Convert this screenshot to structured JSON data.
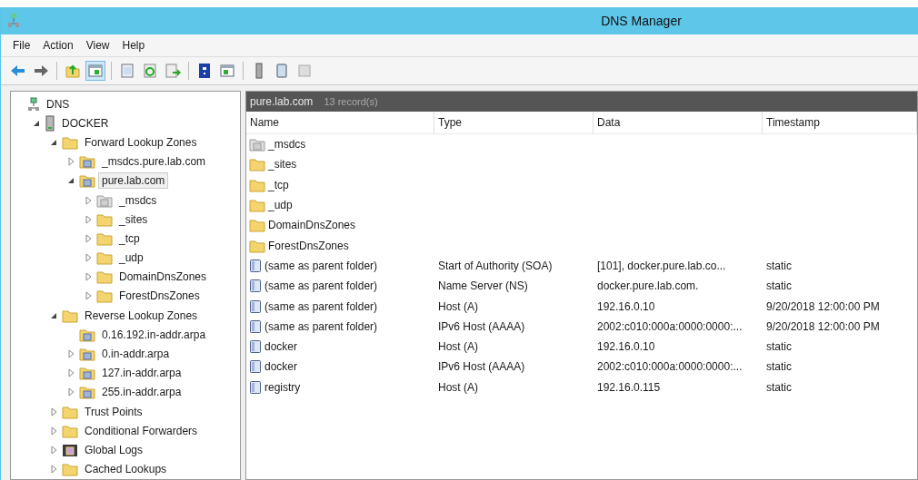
{
  "window": {
    "title": "DNS Manager"
  },
  "menu": [
    "File",
    "Action",
    "View",
    "Help"
  ],
  "toolbar": [
    {
      "kind": "back",
      "pressed": false
    },
    {
      "kind": "forward",
      "pressed": false
    },
    {
      "kind": "sep"
    },
    {
      "kind": "up",
      "pressed": false
    },
    {
      "kind": "tree",
      "pressed": true
    },
    {
      "kind": "sep"
    },
    {
      "kind": "props",
      "pressed": false
    },
    {
      "kind": "refresh",
      "pressed": false
    },
    {
      "kind": "export",
      "pressed": false
    },
    {
      "kind": "sep"
    },
    {
      "kind": "help",
      "pressed": false
    },
    {
      "kind": "pane",
      "pressed": false
    },
    {
      "kind": "sep"
    },
    {
      "kind": "server",
      "pressed": false
    },
    {
      "kind": "book",
      "pressed": false
    },
    {
      "kind": "gray",
      "pressed": false
    }
  ],
  "tree": [
    {
      "label": "DNS",
      "kind": "dns",
      "selected": false,
      "children": [
        {
          "label": "DOCKER",
          "kind": "server",
          "expanded": true,
          "selected": false,
          "children": [
            {
              "label": "Forward Lookup Zones",
              "kind": "folder",
              "expanded": true,
              "selected": false,
              "children": [
                {
                  "label": "_msdcs.pure.lab.com",
                  "kind": "zone",
                  "expanded": false,
                  "selected": false
                },
                {
                  "label": "pure.lab.com",
                  "kind": "zone",
                  "expanded": true,
                  "selected": true,
                  "children": [
                    {
                      "label": "_msdcs",
                      "kind": "delegation",
                      "expanded": false,
                      "selected": false
                    },
                    {
                      "label": "_sites",
                      "kind": "folder",
                      "expanded": false,
                      "selected": false
                    },
                    {
                      "label": "_tcp",
                      "kind": "folder",
                      "expanded": false,
                      "selected": false
                    },
                    {
                      "label": "_udp",
                      "kind": "folder",
                      "expanded": false,
                      "selected": false
                    },
                    {
                      "label": "DomainDnsZones",
                      "kind": "folder",
                      "expanded": false,
                      "selected": false
                    },
                    {
                      "label": "ForestDnsZones",
                      "kind": "folder",
                      "expanded": false,
                      "selected": false
                    }
                  ]
                }
              ]
            },
            {
              "label": "Reverse Lookup Zones",
              "kind": "folder",
              "expanded": true,
              "selected": false,
              "children": [
                {
                  "label": "0.16.192.in-addr.arpa",
                  "kind": "zone",
                  "selected": false
                },
                {
                  "label": "0.in-addr.arpa",
                  "kind": "zone",
                  "expanded": false,
                  "selected": false
                },
                {
                  "label": "127.in-addr.arpa",
                  "kind": "zone",
                  "expanded": false,
                  "selected": false
                },
                {
                  "label": "255.in-addr.arpa",
                  "kind": "zone",
                  "expanded": false,
                  "selected": false
                }
              ]
            },
            {
              "label": "Trust Points",
              "kind": "folder",
              "expanded": false,
              "selected": false
            },
            {
              "label": "Conditional Forwarders",
              "kind": "folder",
              "expanded": false,
              "selected": false
            },
            {
              "label": "Global Logs",
              "kind": "log",
              "expanded": false,
              "selected": false
            },
            {
              "label": "Cached Lookups",
              "kind": "folder",
              "expanded": false,
              "selected": false
            }
          ]
        }
      ]
    }
  ],
  "header": {
    "zone": "pure.lab.com",
    "count": "13 record(s)"
  },
  "table": {
    "columns": [
      "Name",
      "Type",
      "Data",
      "Timestamp"
    ],
    "rows": [
      {
        "kind": "delegation",
        "cells": [
          "_msdcs",
          "",
          "",
          ""
        ]
      },
      {
        "kind": "folder",
        "cells": [
          "_sites",
          "",
          "",
          ""
        ]
      },
      {
        "kind": "folder",
        "cells": [
          "_tcp",
          "",
          "",
          ""
        ]
      },
      {
        "kind": "folder",
        "cells": [
          "_udp",
          "",
          "",
          ""
        ]
      },
      {
        "kind": "folder",
        "cells": [
          "DomainDnsZones",
          "",
          "",
          ""
        ]
      },
      {
        "kind": "folder",
        "cells": [
          "ForestDnsZones",
          "",
          "",
          ""
        ]
      },
      {
        "kind": "record",
        "cells": [
          "(same as parent folder)",
          "Start of Authority (SOA)",
          "[101], docker.pure.lab.co...",
          "static"
        ]
      },
      {
        "kind": "record",
        "cells": [
          "(same as parent folder)",
          "Name Server (NS)",
          "docker.pure.lab.com.",
          "static"
        ]
      },
      {
        "kind": "record",
        "cells": [
          "(same as parent folder)",
          "Host (A)",
          "192.16.0.10",
          "9/20/2018 12:00:00 PM"
        ]
      },
      {
        "kind": "record",
        "cells": [
          "(same as parent folder)",
          "IPv6 Host (AAAA)",
          "2002:c010:000a:0000:0000:...",
          "9/20/2018 12:00:00 PM"
        ]
      },
      {
        "kind": "record",
        "cells": [
          "docker",
          "Host (A)",
          "192.16.0.10",
          "static"
        ]
      },
      {
        "kind": "record",
        "cells": [
          "docker",
          "IPv6 Host (AAAA)",
          "2002:c010:000a:0000:0000:...",
          "static"
        ]
      },
      {
        "kind": "record",
        "cells": [
          "registry",
          "Host (A)",
          "192.16.0.115",
          "static"
        ]
      }
    ]
  }
}
